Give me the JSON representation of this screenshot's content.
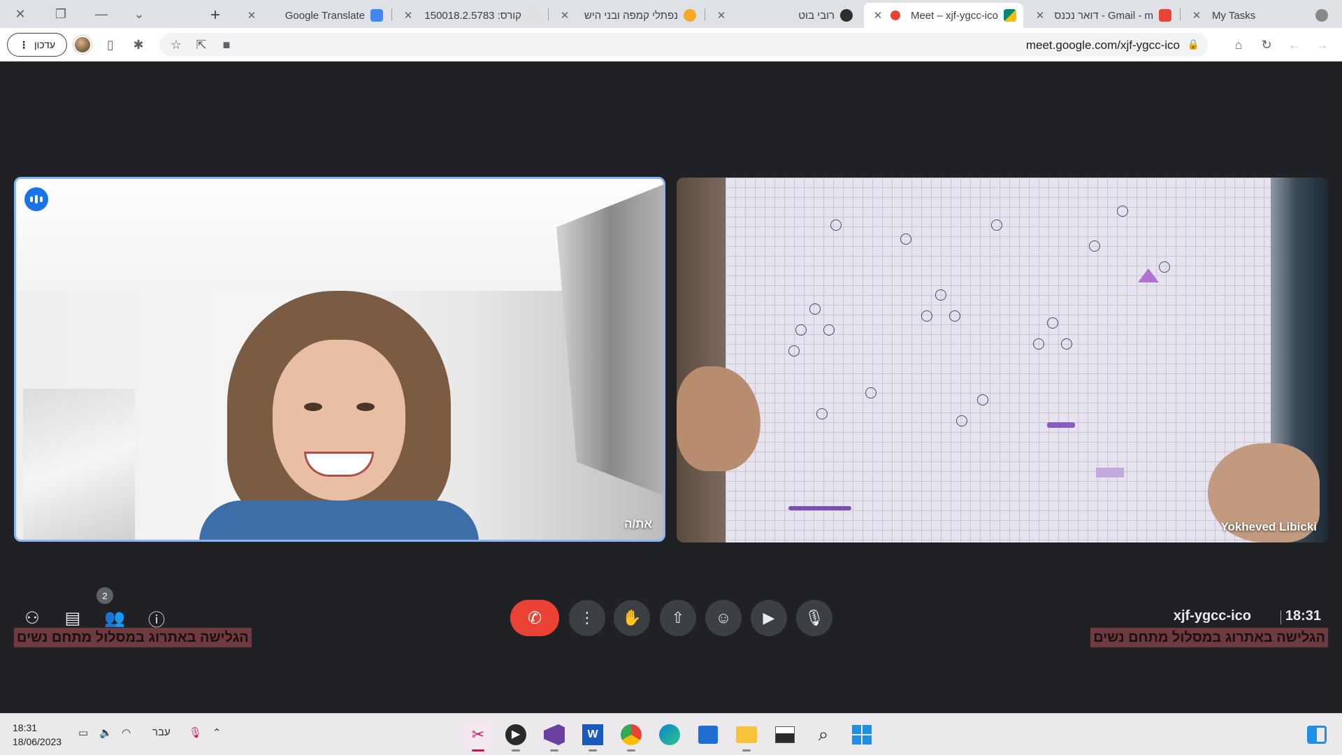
{
  "browser": {
    "tabs": [
      {
        "title": "Google Translate",
        "favicon_color": "#4285f4",
        "active": false
      },
      {
        "title": "קורס: 150018.2.5783",
        "favicon_color": "#e0e0e0",
        "active": false
      },
      {
        "title": "נפתלי קמפה ובני היש",
        "favicon_color": "#f9a825",
        "active": false
      },
      {
        "title": "רובי בוט",
        "favicon_color": "#2e2e2e",
        "active": false
      },
      {
        "title": "Meet – xjf-ygcc-ico",
        "favicon_color": "#00897b",
        "active": true
      },
      {
        "title": "דואר נכנס - Gmail - m",
        "favicon_color": "#ea4335",
        "active": false
      },
      {
        "title": "My Tasks",
        "favicon_color": "#888888",
        "active": false
      }
    ],
    "update_button_label": "עדכון",
    "url": "meet.google.com/xjf-ygcc-ico"
  },
  "meet": {
    "self_label": "את/ה",
    "participant_label": "Yokheved Libicki",
    "meeting_code": "xjf-ygcc-ico",
    "time": "18:31",
    "participants_count": "2",
    "caption_text": "הגלישה באתרוג במסלול מתחם נשים",
    "colors": {
      "end_call": "#ea4335",
      "speaking": "#1a73e8",
      "highlight": "#8ab4f8"
    }
  },
  "taskbar": {
    "time": "18:31",
    "date": "18/06/2023",
    "language": "עבר"
  }
}
